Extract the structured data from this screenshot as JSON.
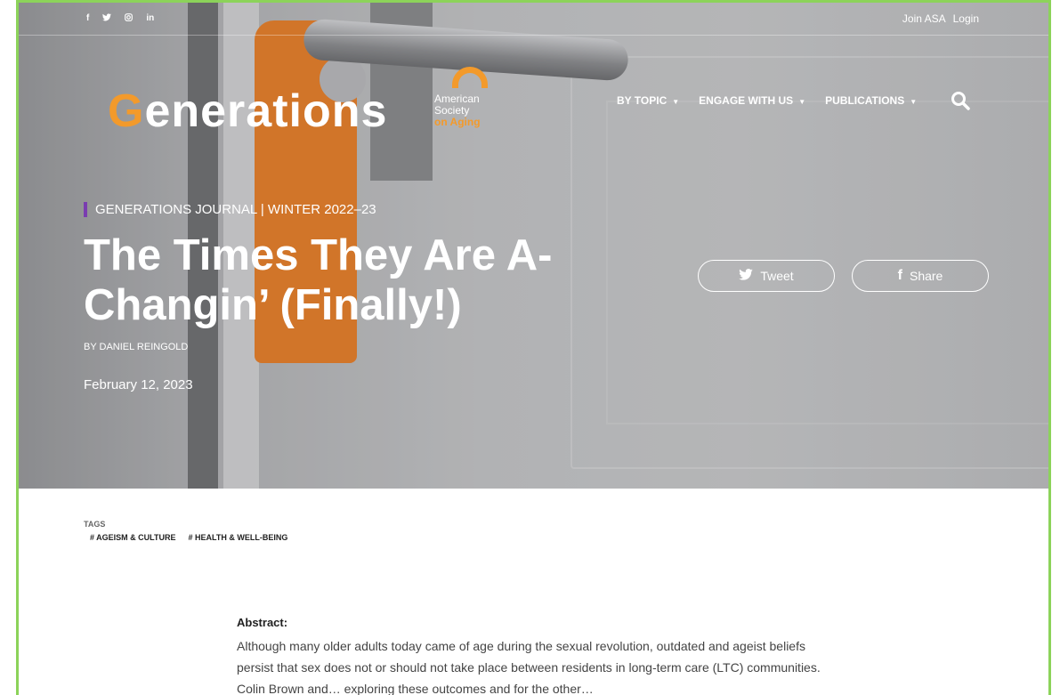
{
  "topbar": {
    "social": [
      {
        "icon": "facebook-icon",
        "glyph": "f"
      },
      {
        "icon": "twitter-icon",
        "glyph": "🐦"
      },
      {
        "icon": "instagram-icon",
        "glyph": "◎"
      },
      {
        "icon": "linkedin-icon",
        "glyph": "in"
      }
    ],
    "join": "Join ASA",
    "login": "Login"
  },
  "logo": {
    "first": "G",
    "rest": "enerations"
  },
  "asa": {
    "line1": "American",
    "line2": "Society",
    "line3": "on Aging"
  },
  "nav": [
    {
      "label": "BY TOPIC"
    },
    {
      "label": "ENGAGE WITH US"
    },
    {
      "label": "PUBLICATIONS"
    }
  ],
  "hero": {
    "kicker": "GENERATIONS JOURNAL | WINTER 2022–23",
    "title": "The Times They Are A-Changin’ (Finally!)",
    "byline": "BY DANIEL REINGOLD",
    "date": "February 12, 2023",
    "tweet": "Tweet",
    "share": "Share"
  },
  "tags": {
    "label": "TAGS",
    "items": [
      "# AGEISM & CULTURE",
      "# HEALTH & WELL-BEING"
    ]
  },
  "abstract": {
    "heading": "Abstract:",
    "text": "Although many older adults today came of age during the sexual revolution, outdated and ageist beliefs persist that sex does not or should not take place between residents in long-term care (LTC) communities. Colin Brown and… exploring these outcomes and for the other…"
  },
  "colors": {
    "accent_orange": "#f39a2b",
    "kicker_bar": "#7a3db0",
    "frame_green": "#8cd35a"
  }
}
